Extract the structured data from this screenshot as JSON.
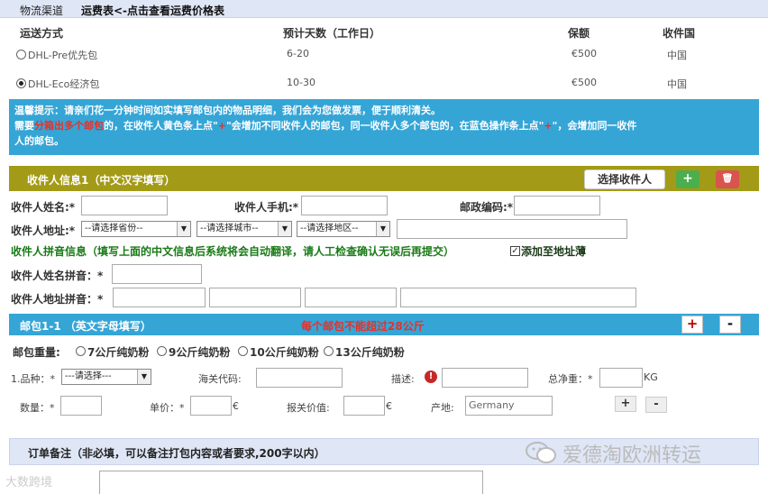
{
  "logistics": {
    "label": "物流渠道",
    "link": "运费表<-点击查看运费价格表",
    "headers": [
      "运送方式",
      "预计天数（工作日）",
      "保额",
      "收件国"
    ],
    "rows": [
      {
        "method": "DHL-Pre优先包",
        "days": "6-20",
        "insured": "€500",
        "country": "中国",
        "selected": false
      },
      {
        "method": "DHL-Eco经济包",
        "days": "10-30",
        "insured": "€500",
        "country": "中国",
        "selected": true
      }
    ]
  },
  "notice": {
    "line1": "温馨提示：请亲们花一分钟时间如实填写邮包内的物品明细，我们会为您做发票，便于顺利清关。",
    "line2_a": "需要",
    "line2_red1": "分箱出多个邮包",
    "line2_b": "的，在收件人黄色条上点\"",
    "line2_red2": "+",
    "line2_c": "\"会增加不同收件人的邮包，同一收件人多个邮包的，在蓝色操作条上点\"",
    "line2_red3": "+",
    "line2_d": "\"，会增加同一收件",
    "line3": "人的邮包。"
  },
  "recipient": {
    "title": "收件人信息1（中文汉字填写）",
    "choose_button": "选择收件人",
    "add_symbol": "+",
    "delete_symbol": "🗑",
    "name_label": "收件人姓名:*",
    "phone_label": "收件人手机:*",
    "zip_label": "邮政编码:*",
    "address_label": "收件人地址:*",
    "province_placeholder": "--请选择省份--",
    "city_placeholder": "--请选择城市--",
    "district_placeholder": "--请选择地区--",
    "pinyin_note": "收件人拼音信息（填写上面的中文信息后系统将会自动翻译，请人工检查确认无误后再提交）",
    "add_to_book": "添加至地址薄",
    "add_to_book_checked": true,
    "name_pinyin_label": "收件人姓名拼音：*",
    "address_pinyin_label": "收件人地址拼音：*"
  },
  "package": {
    "title": "邮包1-1 （英文字母填写）",
    "warning": "每个邮包不能超过28公斤",
    "plus": "+",
    "minus": "-",
    "weight_label": "邮包重量:",
    "weights": [
      "7公斤纯奶粉",
      "9公斤纯奶粉",
      "10公斤纯奶粉",
      "13公斤纯奶粉"
    ],
    "item_label": "1.品种：*",
    "item_placeholder": "---请选择---",
    "customs_code_label": "海关代码:",
    "desc_label": "描述:",
    "net_weight_label": "总净重：*",
    "net_weight_unit": "KG",
    "qty_label": "数量：*",
    "unit_price_label": "单价：*",
    "unit_price_unit": "€",
    "declared_label": "报关价值:",
    "declared_unit": "€",
    "origin_label": "产地:",
    "origin_value": "Germany",
    "row_plus": "+",
    "row_minus": "-"
  },
  "remark": {
    "title": "订单备注（非必填，可以备注打包内容或者要求,200字以内）"
  },
  "watermarks": {
    "wechat": "爱德淘欧洲转运",
    "corner": "大数跨境"
  }
}
